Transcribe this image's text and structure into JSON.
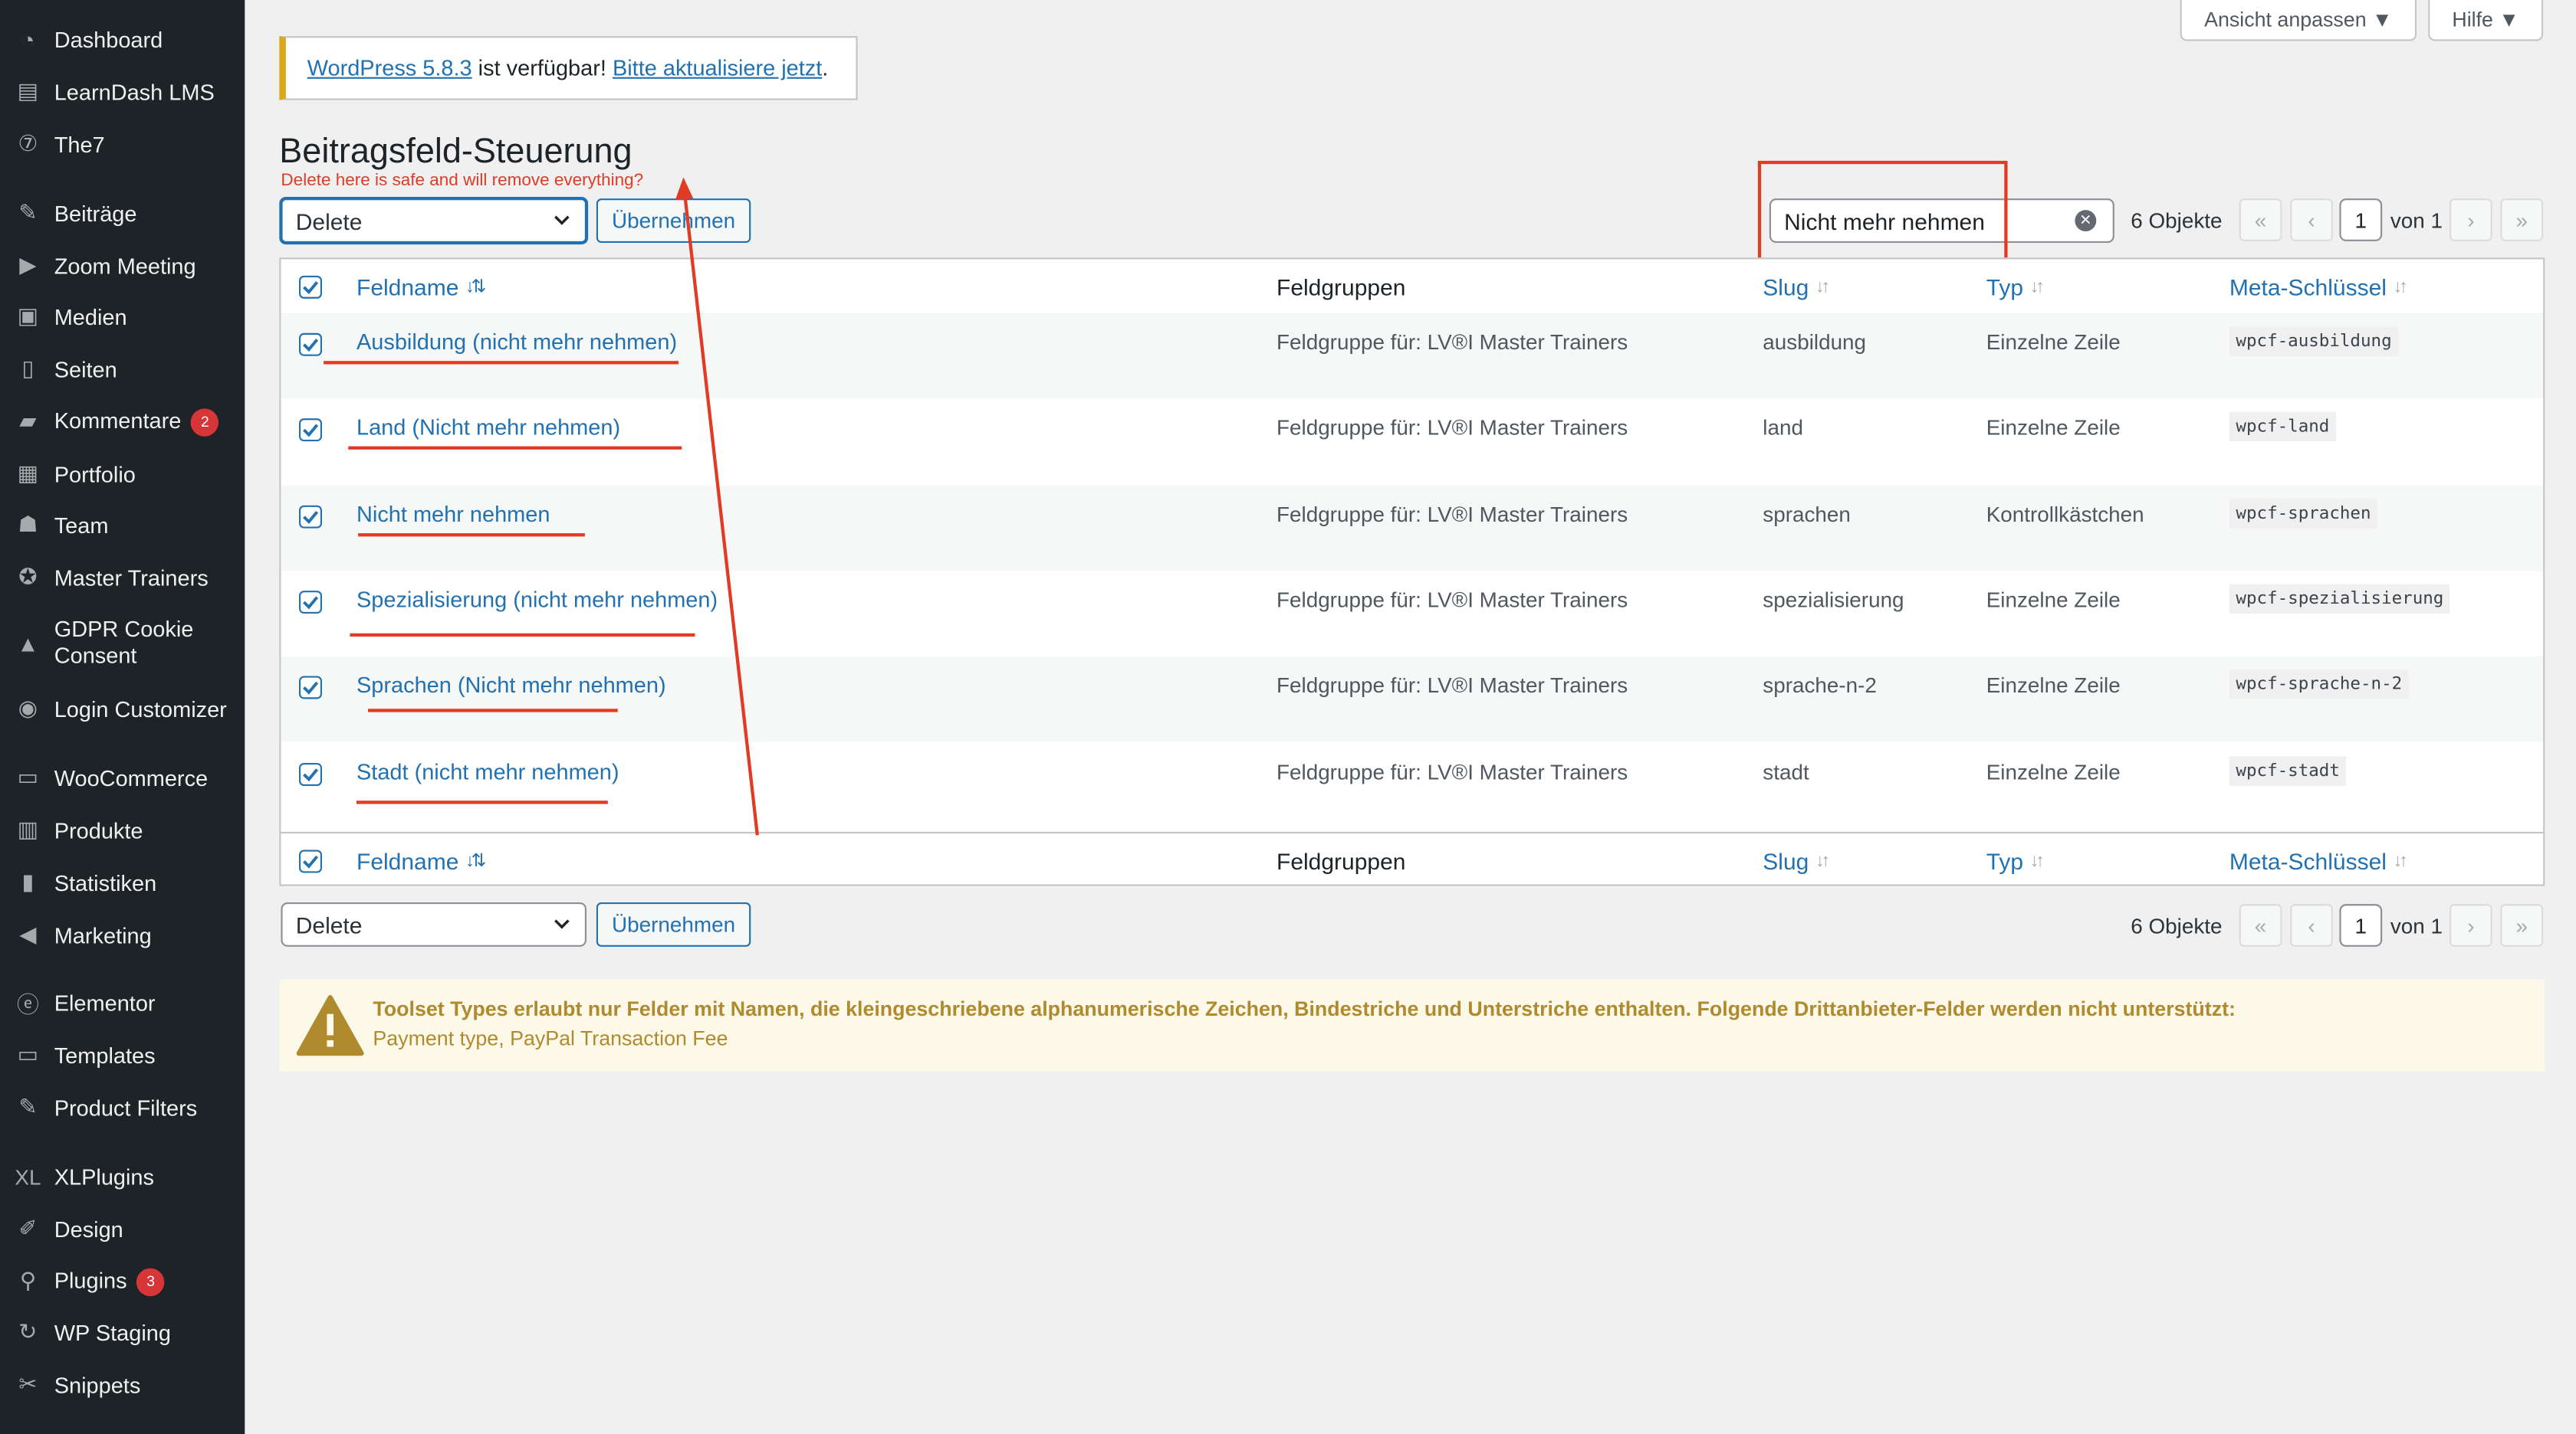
{
  "sidebar": {
    "items": [
      {
        "label": "Dashboard",
        "icon": "dashboard-icon"
      },
      {
        "label": "LearnDash LMS",
        "icon": "learndash-icon"
      },
      {
        "label": "The7",
        "icon": "the7-icon"
      },
      {
        "label": "Beiträge",
        "icon": "pin-icon"
      },
      {
        "label": "Zoom Meeting",
        "icon": "video-icon"
      },
      {
        "label": "Medien",
        "icon": "media-icon"
      },
      {
        "label": "Seiten",
        "icon": "pages-icon"
      },
      {
        "label": "Kommentare",
        "icon": "comment-icon",
        "badge": "2"
      },
      {
        "label": "Portfolio",
        "icon": "portfolio-icon"
      },
      {
        "label": "Team",
        "icon": "team-icon"
      },
      {
        "label": "Master Trainers",
        "icon": "trainer-icon"
      },
      {
        "label": "GDPR Cookie Consent",
        "icon": "lock-icon"
      },
      {
        "label": "Login Customizer",
        "icon": "padlock-icon"
      },
      {
        "label": "WooCommerce",
        "icon": "woo-icon"
      },
      {
        "label": "Produkte",
        "icon": "products-icon"
      },
      {
        "label": "Statistiken",
        "icon": "stats-icon"
      },
      {
        "label": "Marketing",
        "icon": "megaphone-icon"
      },
      {
        "label": "Elementor",
        "icon": "elementor-icon"
      },
      {
        "label": "Templates",
        "icon": "folder-icon"
      },
      {
        "label": "Product Filters",
        "icon": "filter-icon"
      },
      {
        "label": "XLPlugins",
        "icon": "xl-icon"
      },
      {
        "label": "Design",
        "icon": "brush-icon"
      },
      {
        "label": "Plugins",
        "icon": "plugin-icon",
        "badge": "3"
      },
      {
        "label": "WP Staging",
        "icon": "sync-icon"
      },
      {
        "label": "Snippets",
        "icon": "scissors-icon"
      }
    ]
  },
  "top": {
    "screen_options": "Ansicht anpassen ▼",
    "help": "Hilfe ▼"
  },
  "notice": {
    "link1": "WordPress 5.8.3",
    "middle": " ist verfügbar! ",
    "link2": "Bitte aktualisiere jetzt",
    "end": "."
  },
  "page_title": "Beitragsfeld-Steuerung",
  "annotation_text": "Delete here is safe and will remove everything?",
  "bulk": {
    "selected": "Delete",
    "apply": "Übernehmen"
  },
  "search": {
    "value": "Nicht mehr nehmen"
  },
  "pagination": {
    "count": "6 Objekte",
    "first": "«",
    "prev": "‹",
    "current": "1",
    "of": "von 1",
    "next": "›",
    "last": "»"
  },
  "table": {
    "columns": {
      "name": "Feldname",
      "groups": "Feldgruppen",
      "slug": "Slug",
      "type": "Typ",
      "meta": "Meta-Schlüssel"
    },
    "rows": [
      {
        "name": "Ausbildung (nicht mehr nehmen)",
        "group": "Feldgruppe für: LV®I Master Trainers",
        "slug": "ausbildung",
        "type": "Einzelne Zeile",
        "meta": "wpcf-ausbildung"
      },
      {
        "name": "Land (Nicht mehr nehmen)",
        "group": "Feldgruppe für: LV®I Master Trainers",
        "slug": "land",
        "type": "Einzelne Zeile",
        "meta": "wpcf-land"
      },
      {
        "name": "Nicht mehr nehmen",
        "group": "Feldgruppe für: LV®I Master Trainers",
        "slug": "sprachen",
        "type": "Kontrollkästchen",
        "meta": "wpcf-sprachen"
      },
      {
        "name": "Spezialisierung (nicht mehr nehmen)",
        "group": "Feldgruppe für: LV®I Master Trainers",
        "slug": "spezialisierung",
        "type": "Einzelne Zeile",
        "meta": "wpcf-spezialisierung"
      },
      {
        "name": "Sprachen (Nicht mehr nehmen)",
        "group": "Feldgruppe für: LV®I Master Trainers",
        "slug": "sprache-n-2",
        "type": "Einzelne Zeile",
        "meta": "wpcf-sprache-n-2"
      },
      {
        "name": "Stadt (nicht mehr nehmen)",
        "group": "Feldgruppe für: LV®I Master Trainers",
        "slug": "stadt",
        "type": "Einzelne Zeile",
        "meta": "wpcf-stadt"
      }
    ]
  },
  "warning": {
    "line1": "Toolset Types erlaubt nur Felder mit Namen, die kleingeschriebene alphanumerische Zeichen, Bindestriche und Unterstriche enthalten. Folgende Drittanbieter-Felder werden nicht unterstützt:",
    "line2": "Payment type, PayPal Transaction Fee"
  },
  "colors": {
    "accent": "#2271b1",
    "annotation": "#e03b24",
    "sidebar_bg": "#1d2327",
    "warning_text": "#b08a2e"
  }
}
